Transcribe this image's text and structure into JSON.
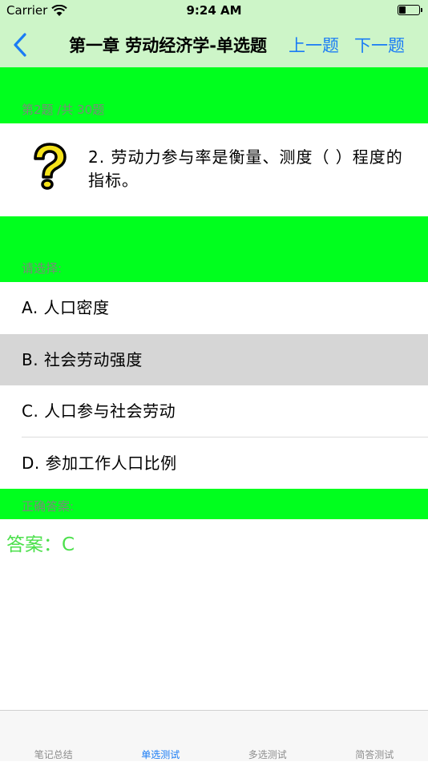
{
  "status_bar": {
    "carrier": "Carrier",
    "time": "9:24 AM"
  },
  "nav": {
    "back_icon": "chevron-left-icon",
    "title": "第一章  劳动经济学-单选题",
    "prev_label": "上一题",
    "next_label": "下一题",
    "link_color": "#1a7cf5"
  },
  "progress_label": "第2题 /共 30题",
  "question": {
    "icon": "question-mark-icon",
    "text": "2. 劳动力参与率是衡量、测度（ ）程度的指标。"
  },
  "options_label": "请选择:",
  "options": [
    {
      "label": "A.  人口密度",
      "selected": false
    },
    {
      "label": "B.  社会劳动强度",
      "selected": true
    },
    {
      "label": "C.  人口参与社会劳动",
      "selected": false
    },
    {
      "label": "D.  参加工作人口比例",
      "selected": false
    }
  ],
  "answer_section_label": "正确答案:",
  "answer_text": "答案：C",
  "colors": {
    "bar_background": "#cdf5c8",
    "band_green": "#00ff1e",
    "answer_green": "#4ce04c",
    "selected_row": "#d6d6d6"
  },
  "tabs": [
    {
      "label": "笔记总结",
      "active": false
    },
    {
      "label": "单选测试",
      "active": true
    },
    {
      "label": "多选测试",
      "active": false
    },
    {
      "label": "简答测试",
      "active": false
    }
  ]
}
